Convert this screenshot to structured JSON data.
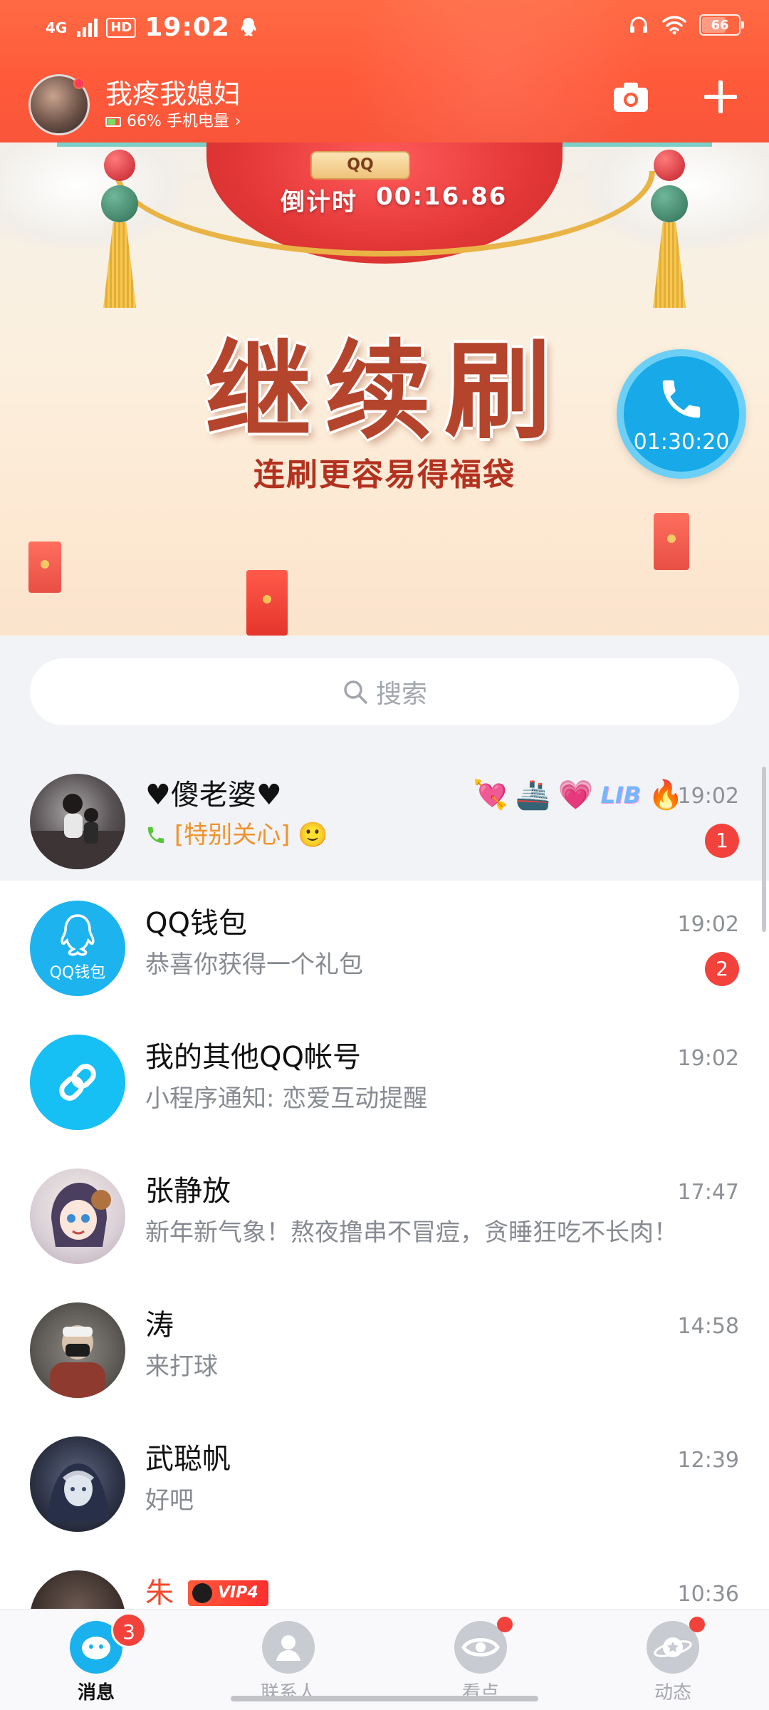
{
  "status_bar": {
    "network": "4G",
    "hd": "HD",
    "time": "19:02",
    "battery": "66"
  },
  "header": {
    "name": "我疼我媳妇",
    "subtitle": "66% 手机电量",
    "subtitle_chevron": "›"
  },
  "banner": {
    "tag": "QQ",
    "countdown_label": "倒计时",
    "countdown_value": "00:16.86",
    "title": "继续刷",
    "subtitle": "连刷更容易得福袋"
  },
  "call": {
    "duration": "01:30:20"
  },
  "search": {
    "placeholder": "搜索"
  },
  "conversations": [
    {
      "name": "♥傻老婆♥",
      "prefix": "[特别关心]",
      "message": "",
      "time": "19:02",
      "unread": "1",
      "pinned": true,
      "emojis": [
        "💘",
        "🚢",
        "💗",
        "🔥"
      ],
      "lib": "LIB"
    },
    {
      "name": "QQ钱包",
      "avatar_label": "QQ钱包",
      "message": "恭喜你获得一个礼包",
      "time": "19:02",
      "unread": "2"
    },
    {
      "name": "我的其他QQ帐号",
      "message": "小程序通知: 恋爱互动提醒",
      "time": "19:02"
    },
    {
      "name": "张静放",
      "message": "新年新气象！熬夜撸串不冒痘，贪睡狂吃不长肉！",
      "time": "17:47"
    },
    {
      "name": "涛",
      "message": "来打球",
      "time": "14:58"
    },
    {
      "name": "武聪帆",
      "message": "好吧",
      "time": "12:39"
    },
    {
      "name": "朱",
      "vip": "VIP4",
      "message": "",
      "time": "10:36"
    }
  ],
  "tabs": [
    {
      "label": "消息",
      "badge": "3",
      "active": true
    },
    {
      "label": "联系人"
    },
    {
      "label": "看点",
      "dot": true
    },
    {
      "label": "动态",
      "dot": true
    }
  ],
  "colors": {
    "header": "#ff5a3a",
    "accent": "#19b2ee",
    "badge": "#f2423b",
    "special": "#f0922a"
  }
}
